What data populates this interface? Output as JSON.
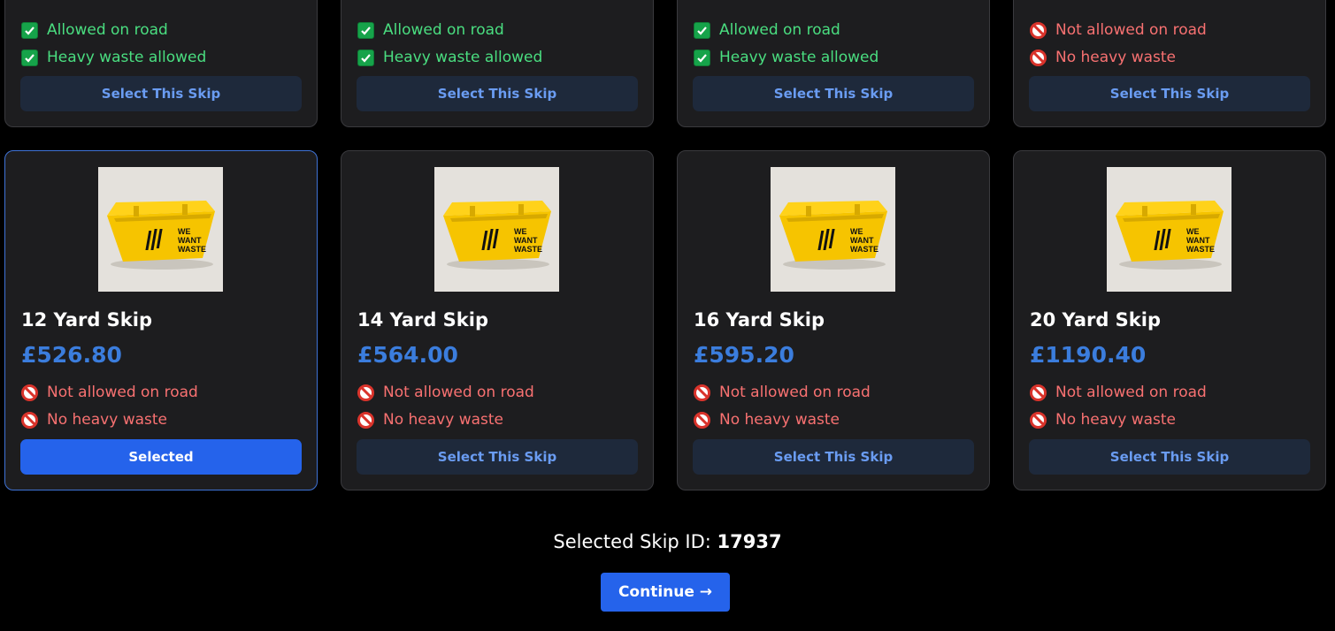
{
  "top_row": [
    {
      "features": [
        {
          "type": "ok",
          "text": "Allowed on road"
        },
        {
          "type": "ok",
          "text": "Heavy waste allowed"
        }
      ],
      "button": "Select This Skip"
    },
    {
      "features": [
        {
          "type": "ok",
          "text": "Allowed on road"
        },
        {
          "type": "ok",
          "text": "Heavy waste allowed"
        }
      ],
      "button": "Select This Skip"
    },
    {
      "features": [
        {
          "type": "ok",
          "text": "Allowed on road"
        },
        {
          "type": "ok",
          "text": "Heavy waste allowed"
        }
      ],
      "button": "Select This Skip"
    },
    {
      "features": [
        {
          "type": "no",
          "text": "Not allowed on road"
        },
        {
          "type": "no",
          "text": "No heavy waste"
        }
      ],
      "button": "Select This Skip"
    }
  ],
  "skips": [
    {
      "title": "12 Yard Skip",
      "price": "£526.80",
      "features": [
        {
          "type": "no",
          "text": "Not allowed on road"
        },
        {
          "type": "no",
          "text": "No heavy waste"
        }
      ],
      "button": "Selected",
      "selected": true
    },
    {
      "title": "14 Yard Skip",
      "price": "£564.00",
      "features": [
        {
          "type": "no",
          "text": "Not allowed on road"
        },
        {
          "type": "no",
          "text": "No heavy waste"
        }
      ],
      "button": "Select This Skip",
      "selected": false
    },
    {
      "title": "16 Yard Skip",
      "price": "£595.20",
      "features": [
        {
          "type": "no",
          "text": "Not allowed on road"
        },
        {
          "type": "no",
          "text": "No heavy waste"
        }
      ],
      "button": "Select This Skip",
      "selected": false
    },
    {
      "title": "20 Yard Skip",
      "price": "£1190.40",
      "features": [
        {
          "type": "no",
          "text": "Not allowed on road"
        },
        {
          "type": "no",
          "text": "No heavy waste"
        }
      ],
      "button": "Select This Skip",
      "selected": false
    }
  ],
  "skip_image": {
    "icon": "yellow-skip-image",
    "logo_lines": [
      "WE",
      "WANT",
      "WASTE"
    ],
    "body_color": "#f6c400",
    "background": "#e4e1dc"
  },
  "footer": {
    "selected_label": "Selected Skip ID:",
    "selected_id": "17937",
    "continue_label": "Continue →"
  },
  "colors": {
    "accent": "#2563eb",
    "price": "#3b7ddd",
    "ok_text": "#4ade80",
    "no_text": "#f87171"
  }
}
